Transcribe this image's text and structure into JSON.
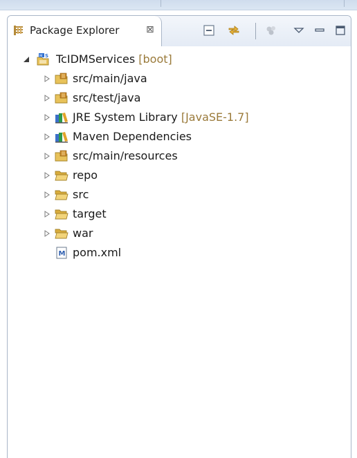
{
  "window": {
    "tab_title": "Package Explorer",
    "tab_close_glyph": "⊠"
  },
  "toolbar": {
    "items": [
      "collapse-all-icon",
      "link-with-editor-icon",
      "focus-on-active-task-icon",
      "view-menu-icon",
      "minimize-icon",
      "maximize-icon"
    ]
  },
  "tree": {
    "project": {
      "label": "TcIDMServices",
      "decoration": "[boot]",
      "expanded": true
    },
    "children": [
      {
        "label": "src/main/java",
        "decoration": "",
        "icon": "source-folder-icon",
        "expandable": true
      },
      {
        "label": "src/test/java",
        "decoration": "",
        "icon": "source-folder-icon",
        "expandable": true
      },
      {
        "label": "JRE System Library",
        "decoration": "[JavaSE-1.7]",
        "icon": "library-icon",
        "expandable": true
      },
      {
        "label": "Maven Dependencies",
        "decoration": "",
        "icon": "library-icon",
        "expandable": true
      },
      {
        "label": "src/main/resources",
        "decoration": "",
        "icon": "source-folder-icon",
        "expandable": true
      },
      {
        "label": "repo",
        "decoration": "",
        "icon": "folder-icon",
        "expandable": true
      },
      {
        "label": "src",
        "decoration": "",
        "icon": "folder-icon",
        "expandable": true
      },
      {
        "label": "target",
        "decoration": "",
        "icon": "folder-icon",
        "expandable": true
      },
      {
        "label": "war",
        "decoration": "",
        "icon": "folder-icon",
        "expandable": true
      },
      {
        "label": "pom.xml",
        "decoration": "",
        "icon": "maven-file-icon",
        "expandable": false
      }
    ]
  },
  "colors": {
    "decoration": "#9a7a3a",
    "folder": "#e8c25a",
    "frame_border": "#a9b6c8"
  }
}
